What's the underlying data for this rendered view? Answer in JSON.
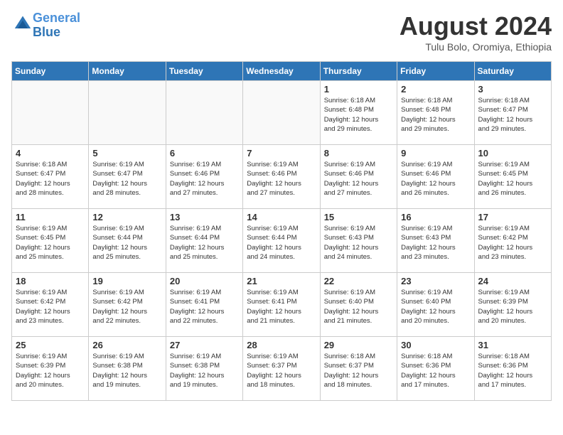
{
  "header": {
    "logo_line1": "General",
    "logo_line2": "Blue",
    "month_year": "August 2024",
    "location": "Tulu Bolo, Oromiya, Ethiopia"
  },
  "weekdays": [
    "Sunday",
    "Monday",
    "Tuesday",
    "Wednesday",
    "Thursday",
    "Friday",
    "Saturday"
  ],
  "weeks": [
    [
      {
        "day": "",
        "info": ""
      },
      {
        "day": "",
        "info": ""
      },
      {
        "day": "",
        "info": ""
      },
      {
        "day": "",
        "info": ""
      },
      {
        "day": "1",
        "info": "Sunrise: 6:18 AM\nSunset: 6:48 PM\nDaylight: 12 hours\nand 29 minutes."
      },
      {
        "day": "2",
        "info": "Sunrise: 6:18 AM\nSunset: 6:48 PM\nDaylight: 12 hours\nand 29 minutes."
      },
      {
        "day": "3",
        "info": "Sunrise: 6:18 AM\nSunset: 6:47 PM\nDaylight: 12 hours\nand 29 minutes."
      }
    ],
    [
      {
        "day": "4",
        "info": "Sunrise: 6:18 AM\nSunset: 6:47 PM\nDaylight: 12 hours\nand 28 minutes."
      },
      {
        "day": "5",
        "info": "Sunrise: 6:19 AM\nSunset: 6:47 PM\nDaylight: 12 hours\nand 28 minutes."
      },
      {
        "day": "6",
        "info": "Sunrise: 6:19 AM\nSunset: 6:46 PM\nDaylight: 12 hours\nand 27 minutes."
      },
      {
        "day": "7",
        "info": "Sunrise: 6:19 AM\nSunset: 6:46 PM\nDaylight: 12 hours\nand 27 minutes."
      },
      {
        "day": "8",
        "info": "Sunrise: 6:19 AM\nSunset: 6:46 PM\nDaylight: 12 hours\nand 27 minutes."
      },
      {
        "day": "9",
        "info": "Sunrise: 6:19 AM\nSunset: 6:46 PM\nDaylight: 12 hours\nand 26 minutes."
      },
      {
        "day": "10",
        "info": "Sunrise: 6:19 AM\nSunset: 6:45 PM\nDaylight: 12 hours\nand 26 minutes."
      }
    ],
    [
      {
        "day": "11",
        "info": "Sunrise: 6:19 AM\nSunset: 6:45 PM\nDaylight: 12 hours\nand 25 minutes."
      },
      {
        "day": "12",
        "info": "Sunrise: 6:19 AM\nSunset: 6:44 PM\nDaylight: 12 hours\nand 25 minutes."
      },
      {
        "day": "13",
        "info": "Sunrise: 6:19 AM\nSunset: 6:44 PM\nDaylight: 12 hours\nand 25 minutes."
      },
      {
        "day": "14",
        "info": "Sunrise: 6:19 AM\nSunset: 6:44 PM\nDaylight: 12 hours\nand 24 minutes."
      },
      {
        "day": "15",
        "info": "Sunrise: 6:19 AM\nSunset: 6:43 PM\nDaylight: 12 hours\nand 24 minutes."
      },
      {
        "day": "16",
        "info": "Sunrise: 6:19 AM\nSunset: 6:43 PM\nDaylight: 12 hours\nand 23 minutes."
      },
      {
        "day": "17",
        "info": "Sunrise: 6:19 AM\nSunset: 6:42 PM\nDaylight: 12 hours\nand 23 minutes."
      }
    ],
    [
      {
        "day": "18",
        "info": "Sunrise: 6:19 AM\nSunset: 6:42 PM\nDaylight: 12 hours\nand 23 minutes."
      },
      {
        "day": "19",
        "info": "Sunrise: 6:19 AM\nSunset: 6:42 PM\nDaylight: 12 hours\nand 22 minutes."
      },
      {
        "day": "20",
        "info": "Sunrise: 6:19 AM\nSunset: 6:41 PM\nDaylight: 12 hours\nand 22 minutes."
      },
      {
        "day": "21",
        "info": "Sunrise: 6:19 AM\nSunset: 6:41 PM\nDaylight: 12 hours\nand 21 minutes."
      },
      {
        "day": "22",
        "info": "Sunrise: 6:19 AM\nSunset: 6:40 PM\nDaylight: 12 hours\nand 21 minutes."
      },
      {
        "day": "23",
        "info": "Sunrise: 6:19 AM\nSunset: 6:40 PM\nDaylight: 12 hours\nand 20 minutes."
      },
      {
        "day": "24",
        "info": "Sunrise: 6:19 AM\nSunset: 6:39 PM\nDaylight: 12 hours\nand 20 minutes."
      }
    ],
    [
      {
        "day": "25",
        "info": "Sunrise: 6:19 AM\nSunset: 6:39 PM\nDaylight: 12 hours\nand 20 minutes."
      },
      {
        "day": "26",
        "info": "Sunrise: 6:19 AM\nSunset: 6:38 PM\nDaylight: 12 hours\nand 19 minutes."
      },
      {
        "day": "27",
        "info": "Sunrise: 6:19 AM\nSunset: 6:38 PM\nDaylight: 12 hours\nand 19 minutes."
      },
      {
        "day": "28",
        "info": "Sunrise: 6:19 AM\nSunset: 6:37 PM\nDaylight: 12 hours\nand 18 minutes."
      },
      {
        "day": "29",
        "info": "Sunrise: 6:18 AM\nSunset: 6:37 PM\nDaylight: 12 hours\nand 18 minutes."
      },
      {
        "day": "30",
        "info": "Sunrise: 6:18 AM\nSunset: 6:36 PM\nDaylight: 12 hours\nand 17 minutes."
      },
      {
        "day": "31",
        "info": "Sunrise: 6:18 AM\nSunset: 6:36 PM\nDaylight: 12 hours\nand 17 minutes."
      }
    ]
  ]
}
